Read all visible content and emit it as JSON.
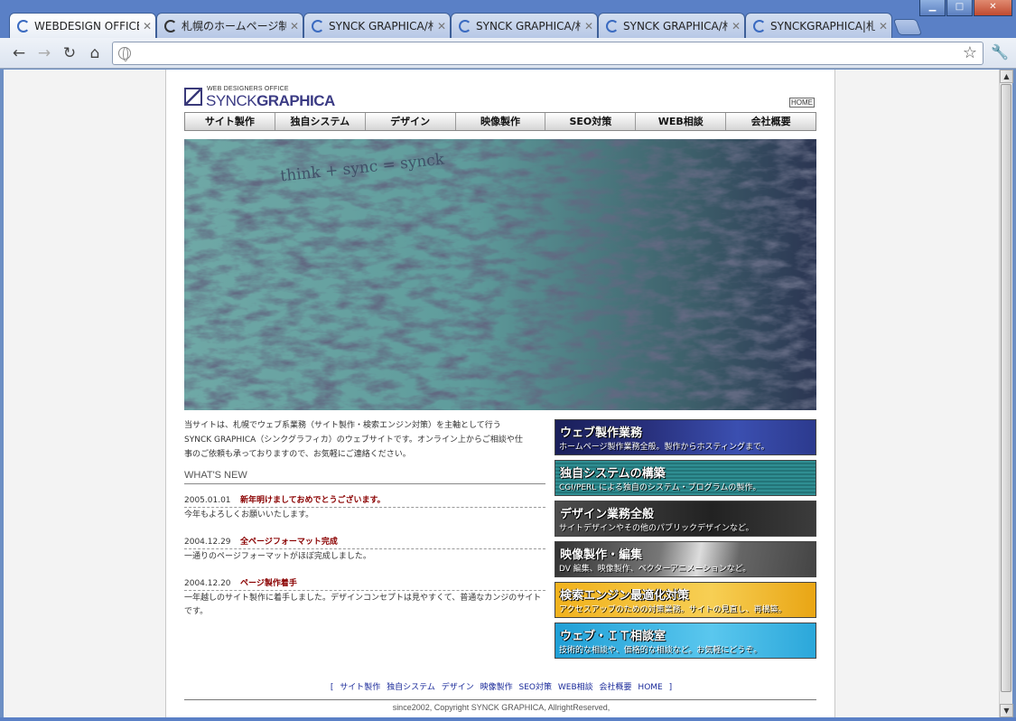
{
  "browser": {
    "tabs": [
      {
        "label": "WEBDESIGN OFFICE :",
        "active": true
      },
      {
        "label": "札幌のホームページ制作",
        "active": false
      },
      {
        "label": "SYNCK GRAPHICA/札",
        "active": false
      },
      {
        "label": "SYNCK GRAPHICA/札",
        "active": false
      },
      {
        "label": "SYNCK GRAPHICA/札",
        "active": false
      },
      {
        "label": "SYNCKGRAPHICA|札幌",
        "active": false
      }
    ],
    "window_buttons": [
      "minimize",
      "maximize",
      "close"
    ],
    "address_value": "",
    "nav_icons": [
      "back-arrow-icon",
      "forward-arrow-icon",
      "reload-icon",
      "home-icon"
    ]
  },
  "site": {
    "logo": {
      "sub": "WEB DESIGNERS OFFICE",
      "main_light": "SYNCK",
      "main_bold": "GRAPHICA"
    },
    "home_link": "HOME",
    "gnav": [
      "サイト製作",
      "独自システム",
      "デザイン",
      "映像製作",
      "SEO対策",
      "WEB相談",
      "会社概要"
    ],
    "hero_text": "think + sync = synck",
    "intro": "当サイトは、札幌でウェブ系業務（サイト製作・検索エンジン対策）を主軸として行うSYNCK GRAPHICA（シンクグラフィカ）のウェブサイトです。オンライン上からご相談や仕事のご依頼も承っておりますので、お気軽にご連絡ください。",
    "whats_new_heading": "WHAT'S NEW",
    "news": [
      {
        "date": "2005.01.01",
        "title": "新年明けましておめでとうございます。",
        "body": "今年もよろしくお願いいたします。"
      },
      {
        "date": "2004.12.29",
        "title": "全ページフォーマット完成",
        "body": "一通りのページフォーマットがほぼ完成しました。"
      },
      {
        "date": "2004.12.20",
        "title": "ページ製作着手",
        "body": "一年越しのサイト製作に着手しました。デザインコンセプトは見やすくて、普通なカンジのサイトです。"
      }
    ],
    "services": [
      {
        "title": "ウェブ製作業務",
        "desc": "ホームページ製作業務全般。製作からホスティングまで。"
      },
      {
        "title": "独自システムの構築",
        "desc": "CGI/PERL による独自のシステム・プログラムの製作。"
      },
      {
        "title": "デザイン業務全般",
        "desc": "サイトデザインやその他のパブリックデザインなど。"
      },
      {
        "title": "映像製作・編集",
        "desc": "DV 編集、映像製作、ベクターアニメーションなど。"
      },
      {
        "title": "検索エンジン最適化対策",
        "desc": "アクセスアップのための対策業務。サイトの見直し、再構築。"
      },
      {
        "title": "ウェブ・ＩＴ相談室",
        "desc": "技術的な相談や、価格的な相談など。お気軽にどうぞ。"
      }
    ],
    "footer": {
      "bracket_open": "[",
      "bracket_close": "]",
      "links": [
        "サイト製作",
        "独自システム",
        "デザイン",
        "映像製作",
        "SEO対策",
        "WEB相談",
        "会社概要",
        "HOME"
      ],
      "copyright": "since2002, Copyright SYNCK GRAPHICA, AllrightReserved,"
    }
  },
  "colors": {
    "accent": "#3b3b84",
    "news_title": "#8a0000",
    "footer_link": "#1a2a9a",
    "chrome": "#5a80c6"
  }
}
